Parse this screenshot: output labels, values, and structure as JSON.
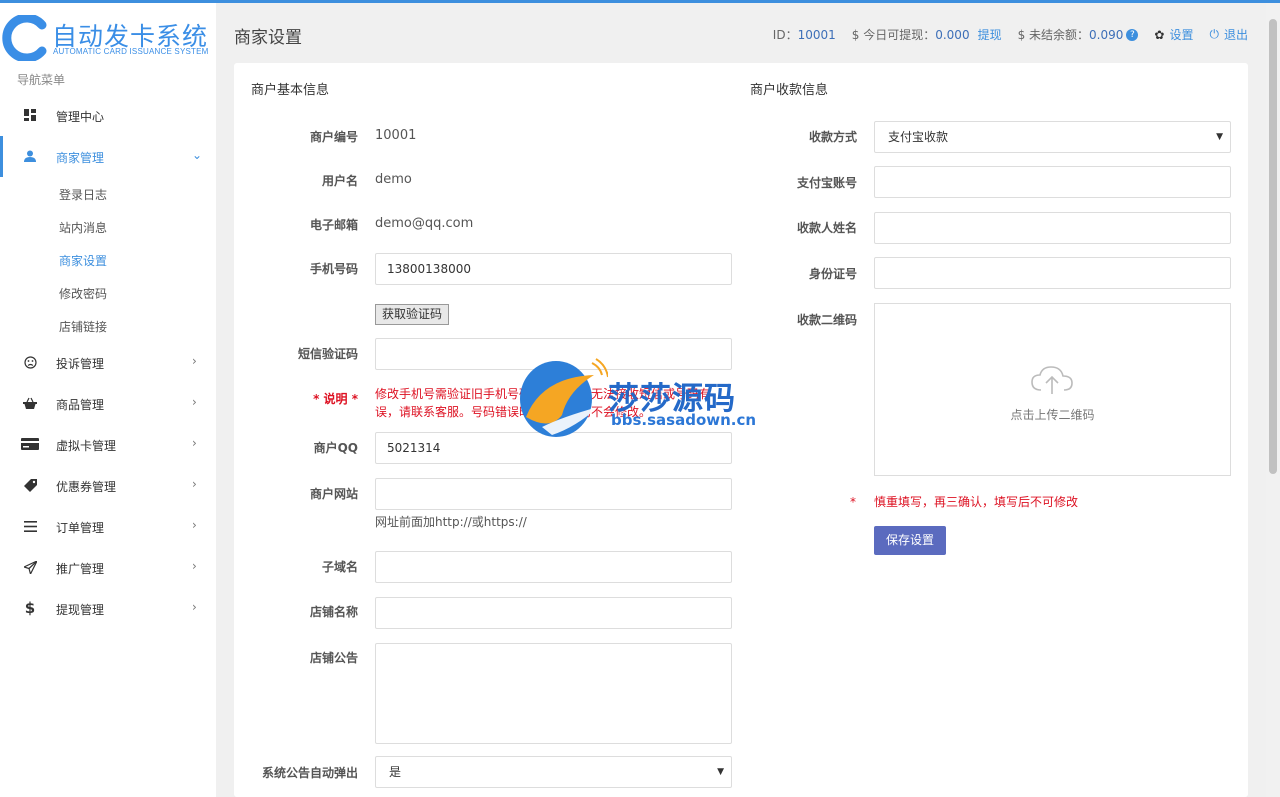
{
  "brand": {
    "name_cn": "自动发卡系统",
    "name_en": "AUTOMATIC CARD ISSUANCE SYSTEM",
    "color": "#3a8ee6"
  },
  "sidebar": {
    "title": "导航菜单",
    "items": [
      {
        "label": "管理中心",
        "icon": "dashboard-icon"
      },
      {
        "label": "商家管理",
        "icon": "user-icon",
        "active": true
      },
      {
        "label": "投诉管理",
        "icon": "frown-icon"
      },
      {
        "label": "商品管理",
        "icon": "basket-icon"
      },
      {
        "label": "虚拟卡管理",
        "icon": "card-icon"
      },
      {
        "label": "优惠券管理",
        "icon": "tag-icon"
      },
      {
        "label": "订单管理",
        "icon": "list-icon"
      },
      {
        "label": "推广管理",
        "icon": "send-icon"
      },
      {
        "label": "提现管理",
        "icon": "dollar-icon"
      }
    ],
    "sub_items": [
      {
        "label": "登录日志"
      },
      {
        "label": "站内消息"
      },
      {
        "label": "商家设置",
        "active": true
      },
      {
        "label": "修改密码"
      },
      {
        "label": "店铺链接"
      }
    ]
  },
  "header": {
    "title": "商家设置",
    "id_label": "ID：",
    "id_value": "10001",
    "withdrawable_label": "$ 今日可提现：",
    "withdrawable_value": "0.000",
    "withdraw_link": "提现",
    "unsettled_label": "$ 未结余额：",
    "unsettled_value": "0.090",
    "badge": "?",
    "settings_label": "设置",
    "logout_label": "退出"
  },
  "basic": {
    "title": "商户基本信息",
    "merchant_no_label": "商户编号",
    "merchant_no": "10001",
    "username_label": "用户名",
    "username": "demo",
    "email_label": "电子邮箱",
    "email": "demo@qq.com",
    "phone_label": "手机号码",
    "phone": "13800138000",
    "get_code_button": "获取验证码",
    "sms_label": "短信验证码",
    "sms_value": "",
    "note_label": "* 说明 *",
    "note_text": "修改手机号需验证旧手机号码，若旧号码无法接收短信或号码有误，请联系客服。号码错误时，手机号码不会修改。",
    "qq_label": "商户QQ",
    "qq": "5021314",
    "website_label": "商户网站",
    "website": "",
    "website_hint": "网址前面加http://或https://",
    "subdomain_label": "子域名",
    "subdomain": "",
    "shop_name_label": "店铺名称",
    "shop_name": "",
    "notice_label": "店铺公告",
    "notice": "",
    "popup_label": "系统公告自动弹出",
    "popup_value": "是"
  },
  "payment": {
    "title": "商户收款信息",
    "method_label": "收款方式",
    "method_value": "支付宝收款",
    "alipay_label": "支付宝账号",
    "alipay": "",
    "payee_label": "收款人姓名",
    "payee": "",
    "idcard_label": "身份证号",
    "idcard": "",
    "qrcode_label": "收款二维码",
    "upload_text": "点击上传二维码",
    "warning_star": "*",
    "warning_text": "慎重填写，再三确认，填写后不可修改",
    "save_button": "保存设置"
  },
  "watermark": {
    "text": "莎莎源码",
    "url": "bbs.sasadown.cn"
  },
  "colors": {
    "accent": "#3d8fde",
    "save_button": "#5b6bbf",
    "warning": "#dd1122"
  }
}
